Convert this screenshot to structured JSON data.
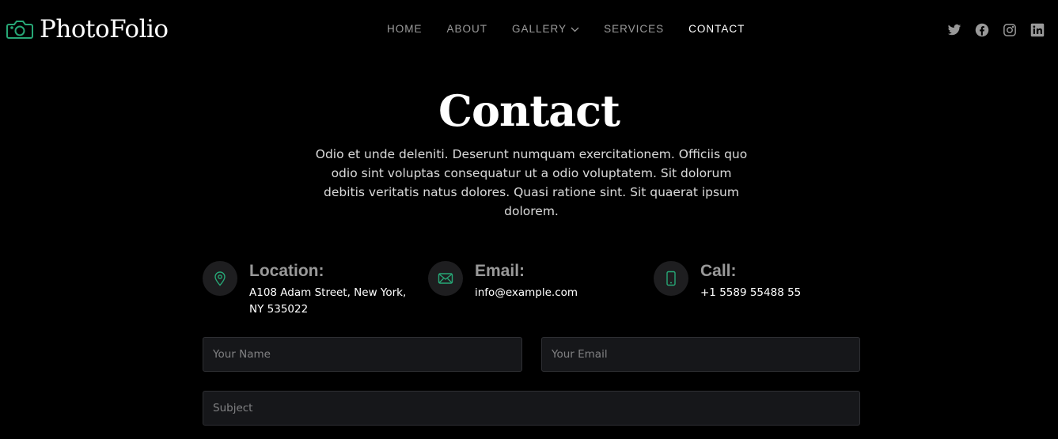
{
  "brand": {
    "name": "PhotoFolio",
    "accent": "#27a776"
  },
  "nav": {
    "items": [
      {
        "label": "HOME"
      },
      {
        "label": "ABOUT"
      },
      {
        "label": "GALLERY"
      },
      {
        "label": "SERVICES"
      },
      {
        "label": "CONTACT"
      }
    ],
    "active": "CONTACT"
  },
  "socials": [
    "twitter-icon",
    "facebook-icon",
    "instagram-icon",
    "linkedin-icon"
  ],
  "hero": {
    "title": "Contact",
    "description": "Odio et unde deleniti. Deserunt numquam exercitationem. Officiis quo odio sint voluptas consequatur ut a odio voluptatem. Sit dolorum debitis veritatis natus dolores. Quasi ratione sint. Sit quaerat ipsum dolorem."
  },
  "info": {
    "location": {
      "title": "Location:",
      "text": "A108 Adam Street, New York, NY 535022",
      "icon": "map-pin-icon"
    },
    "email": {
      "title": "Email:",
      "text": "info@example.com",
      "icon": "envelope-icon"
    },
    "call": {
      "title": "Call:",
      "text": "+1 5589 55488 55",
      "icon": "phone-icon"
    }
  },
  "form": {
    "name_placeholder": "Your Name",
    "email_placeholder": "Your Email",
    "subject_placeholder": "Subject"
  }
}
